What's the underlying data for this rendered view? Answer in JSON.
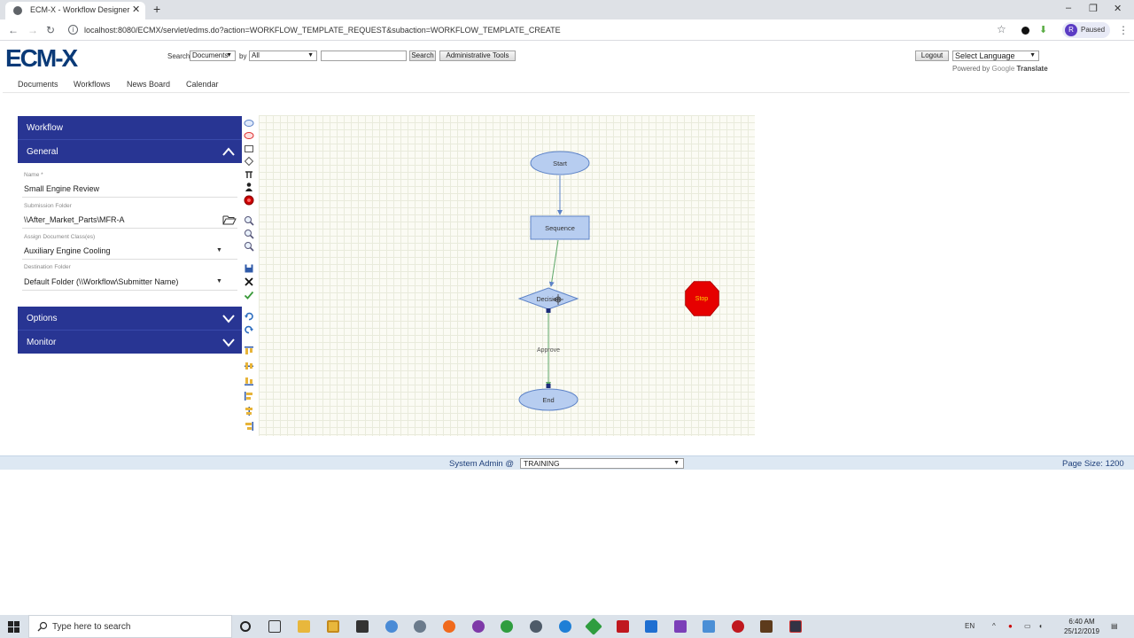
{
  "browser": {
    "tab_title": "ECM-X - Workflow Designer",
    "url": "localhost:8080/ECMX/servlet/edms.do?action=WORKFLOW_TEMPLATE_REQUEST&subaction=WORKFLOW_TEMPLATE_CREATE",
    "profile_initial": "R",
    "profile_status": "Paused"
  },
  "app": {
    "logo": "ECM-X",
    "search_label": "Search",
    "search_scope": "Documents",
    "by_label": "by",
    "by_value": "All",
    "search_button": "Search",
    "admin_tools_button": "Administrative Tools",
    "logout_button": "Logout",
    "language_select": "Select Language",
    "powered_by": "Powered by",
    "google": "Google",
    "translate": "Translate"
  },
  "nav": {
    "items": [
      "Documents",
      "Workflows",
      "News Board",
      "Calendar"
    ]
  },
  "panel": {
    "title": "Workflow",
    "general": "General",
    "fields": [
      {
        "label": "Name *",
        "value": "Small Engine Review"
      },
      {
        "label": "Submission Folder",
        "value": "\\\\After_Market_Parts\\MFR-A"
      },
      {
        "label": "Assign Document Class(es)",
        "value": "Auxiliary Engine Cooling"
      },
      {
        "label": "Destination Folder",
        "value": "Default Folder (\\\\Workflow\\Submitter Name)"
      }
    ],
    "options": "Options",
    "monitor": "Monitor"
  },
  "tools": [
    "ellipse-tool-icon",
    "stop-ellipse-tool-icon",
    "rectangle-tool-icon",
    "diamond-tool-icon",
    "connector-tool-icon",
    "user-tool-icon",
    "record-tool-icon",
    "zoom-in-icon",
    "zoom-out-icon",
    "zoom-fit-icon",
    "save-icon",
    "delete-icon",
    "validate-icon",
    "undo-icon",
    "redo-icon",
    "align-top-icon",
    "align-middle-icon",
    "align-bottom-icon",
    "align-left-icon",
    "align-center-icon",
    "align-right-icon"
  ],
  "diagram": {
    "start": "Start",
    "sequence": "Sequence",
    "decision": "Decision",
    "approve": "Approve",
    "end": "End",
    "stop": "Stop",
    "colors": {
      "node_fill": "#b7cdf0",
      "node_stroke": "#5d83c7",
      "stop_fill": "#e60000",
      "stop_text": "#ffd400",
      "edge_decision": "#5ea86a"
    }
  },
  "status": {
    "user": "System Admin @",
    "environment": "TRAINING",
    "page_size": "Page Size: 1200"
  },
  "taskbar": {
    "search_placeholder": "Type here to search",
    "lang": "EN",
    "time": "6:40 AM",
    "date": "25/12/2019"
  }
}
